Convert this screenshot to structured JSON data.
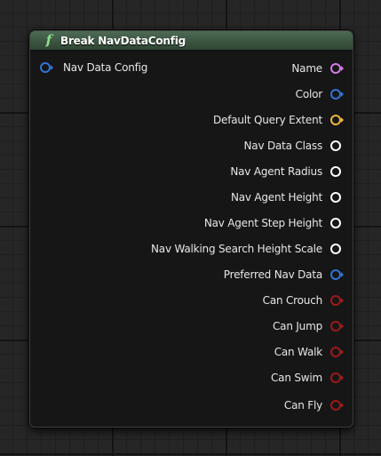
{
  "node": {
    "title": "Break NavDataConfig",
    "icon": "function-icon",
    "input": {
      "label": "Nav Data Config",
      "color": "#2f74d8"
    },
    "outputs": [
      {
        "label": "Name",
        "color": "#d27ee8",
        "arrow": true
      },
      {
        "label": "Color",
        "color": "#2f74d8",
        "arrow": true
      },
      {
        "label": "Default Query Extent",
        "color": "#f0b73a",
        "arrow": true
      },
      {
        "label": "Nav Data Class",
        "color": "#ffffff",
        "arrow": false
      },
      {
        "label": "Nav Agent Radius",
        "color": "#ffffff",
        "arrow": false
      },
      {
        "label": "Nav Agent Height",
        "color": "#ffffff",
        "arrow": false
      },
      {
        "label": "Nav Agent Step Height",
        "color": "#ffffff",
        "arrow": false
      },
      {
        "label": "Nav Walking Search Height Scale",
        "color": "#ffffff",
        "arrow": false
      },
      {
        "label": "Preferred Nav Data",
        "color": "#2f74d8",
        "arrow": true
      },
      {
        "label": "Can Crouch",
        "color": "#a21818",
        "arrow": true
      },
      {
        "label": "Can Jump",
        "color": "#a21818",
        "arrow": true
      },
      {
        "label": "Can Walk",
        "color": "#a21818",
        "arrow": true
      },
      {
        "label": "Can Swim",
        "color": "#a21818",
        "arrow": true
      },
      {
        "label": "Can Fly",
        "color": "#a21818",
        "arrow": true
      }
    ]
  }
}
